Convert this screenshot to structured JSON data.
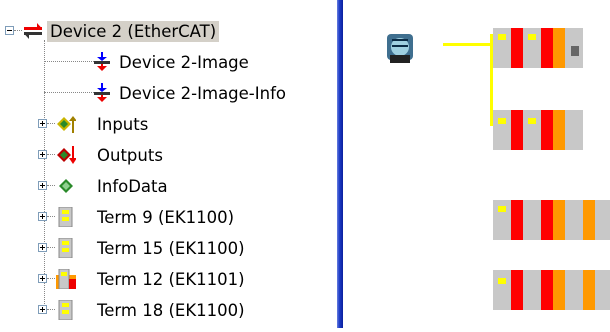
{
  "tree": {
    "root": {
      "label": "Device 2 (EtherCAT)",
      "icon": "ethercat-device-icon"
    },
    "children": [
      {
        "label": "Device 2-Image",
        "icon": "image-icon",
        "expander": false
      },
      {
        "label": "Device 2-Image-Info",
        "icon": "image-info-icon",
        "expander": false
      },
      {
        "label": "Inputs",
        "icon": "inputs-icon",
        "expander": true
      },
      {
        "label": "Outputs",
        "icon": "outputs-icon",
        "expander": true
      },
      {
        "label": "InfoData",
        "icon": "infodata-icon",
        "expander": true
      },
      {
        "label": "Term 9 (EK1100)",
        "icon": "terminal-ek1100-icon",
        "expander": true
      },
      {
        "label": "Term 15 (EK1100)",
        "icon": "terminal-ek1100-icon",
        "expander": true
      },
      {
        "label": "Term 12 (EK1101)",
        "icon": "terminal-ek1101-icon",
        "expander": true
      },
      {
        "label": "Term 18 (EK1100)",
        "icon": "terminal-ek1100-icon",
        "expander": true
      }
    ]
  },
  "topology": {
    "master_icon": "ethercat-master-icon",
    "groups": [
      "coupler-group-1",
      "coupler-group-2",
      "coupler-group-3",
      "coupler-group-4"
    ]
  },
  "colors": {
    "selection": "#d4d0c8",
    "splitter": "#1d3cc7",
    "cable": "#ffff00",
    "terminal_red": "#ff0000",
    "terminal_orange": "#ff9900",
    "terminal_grey": "#c8c8c8"
  }
}
